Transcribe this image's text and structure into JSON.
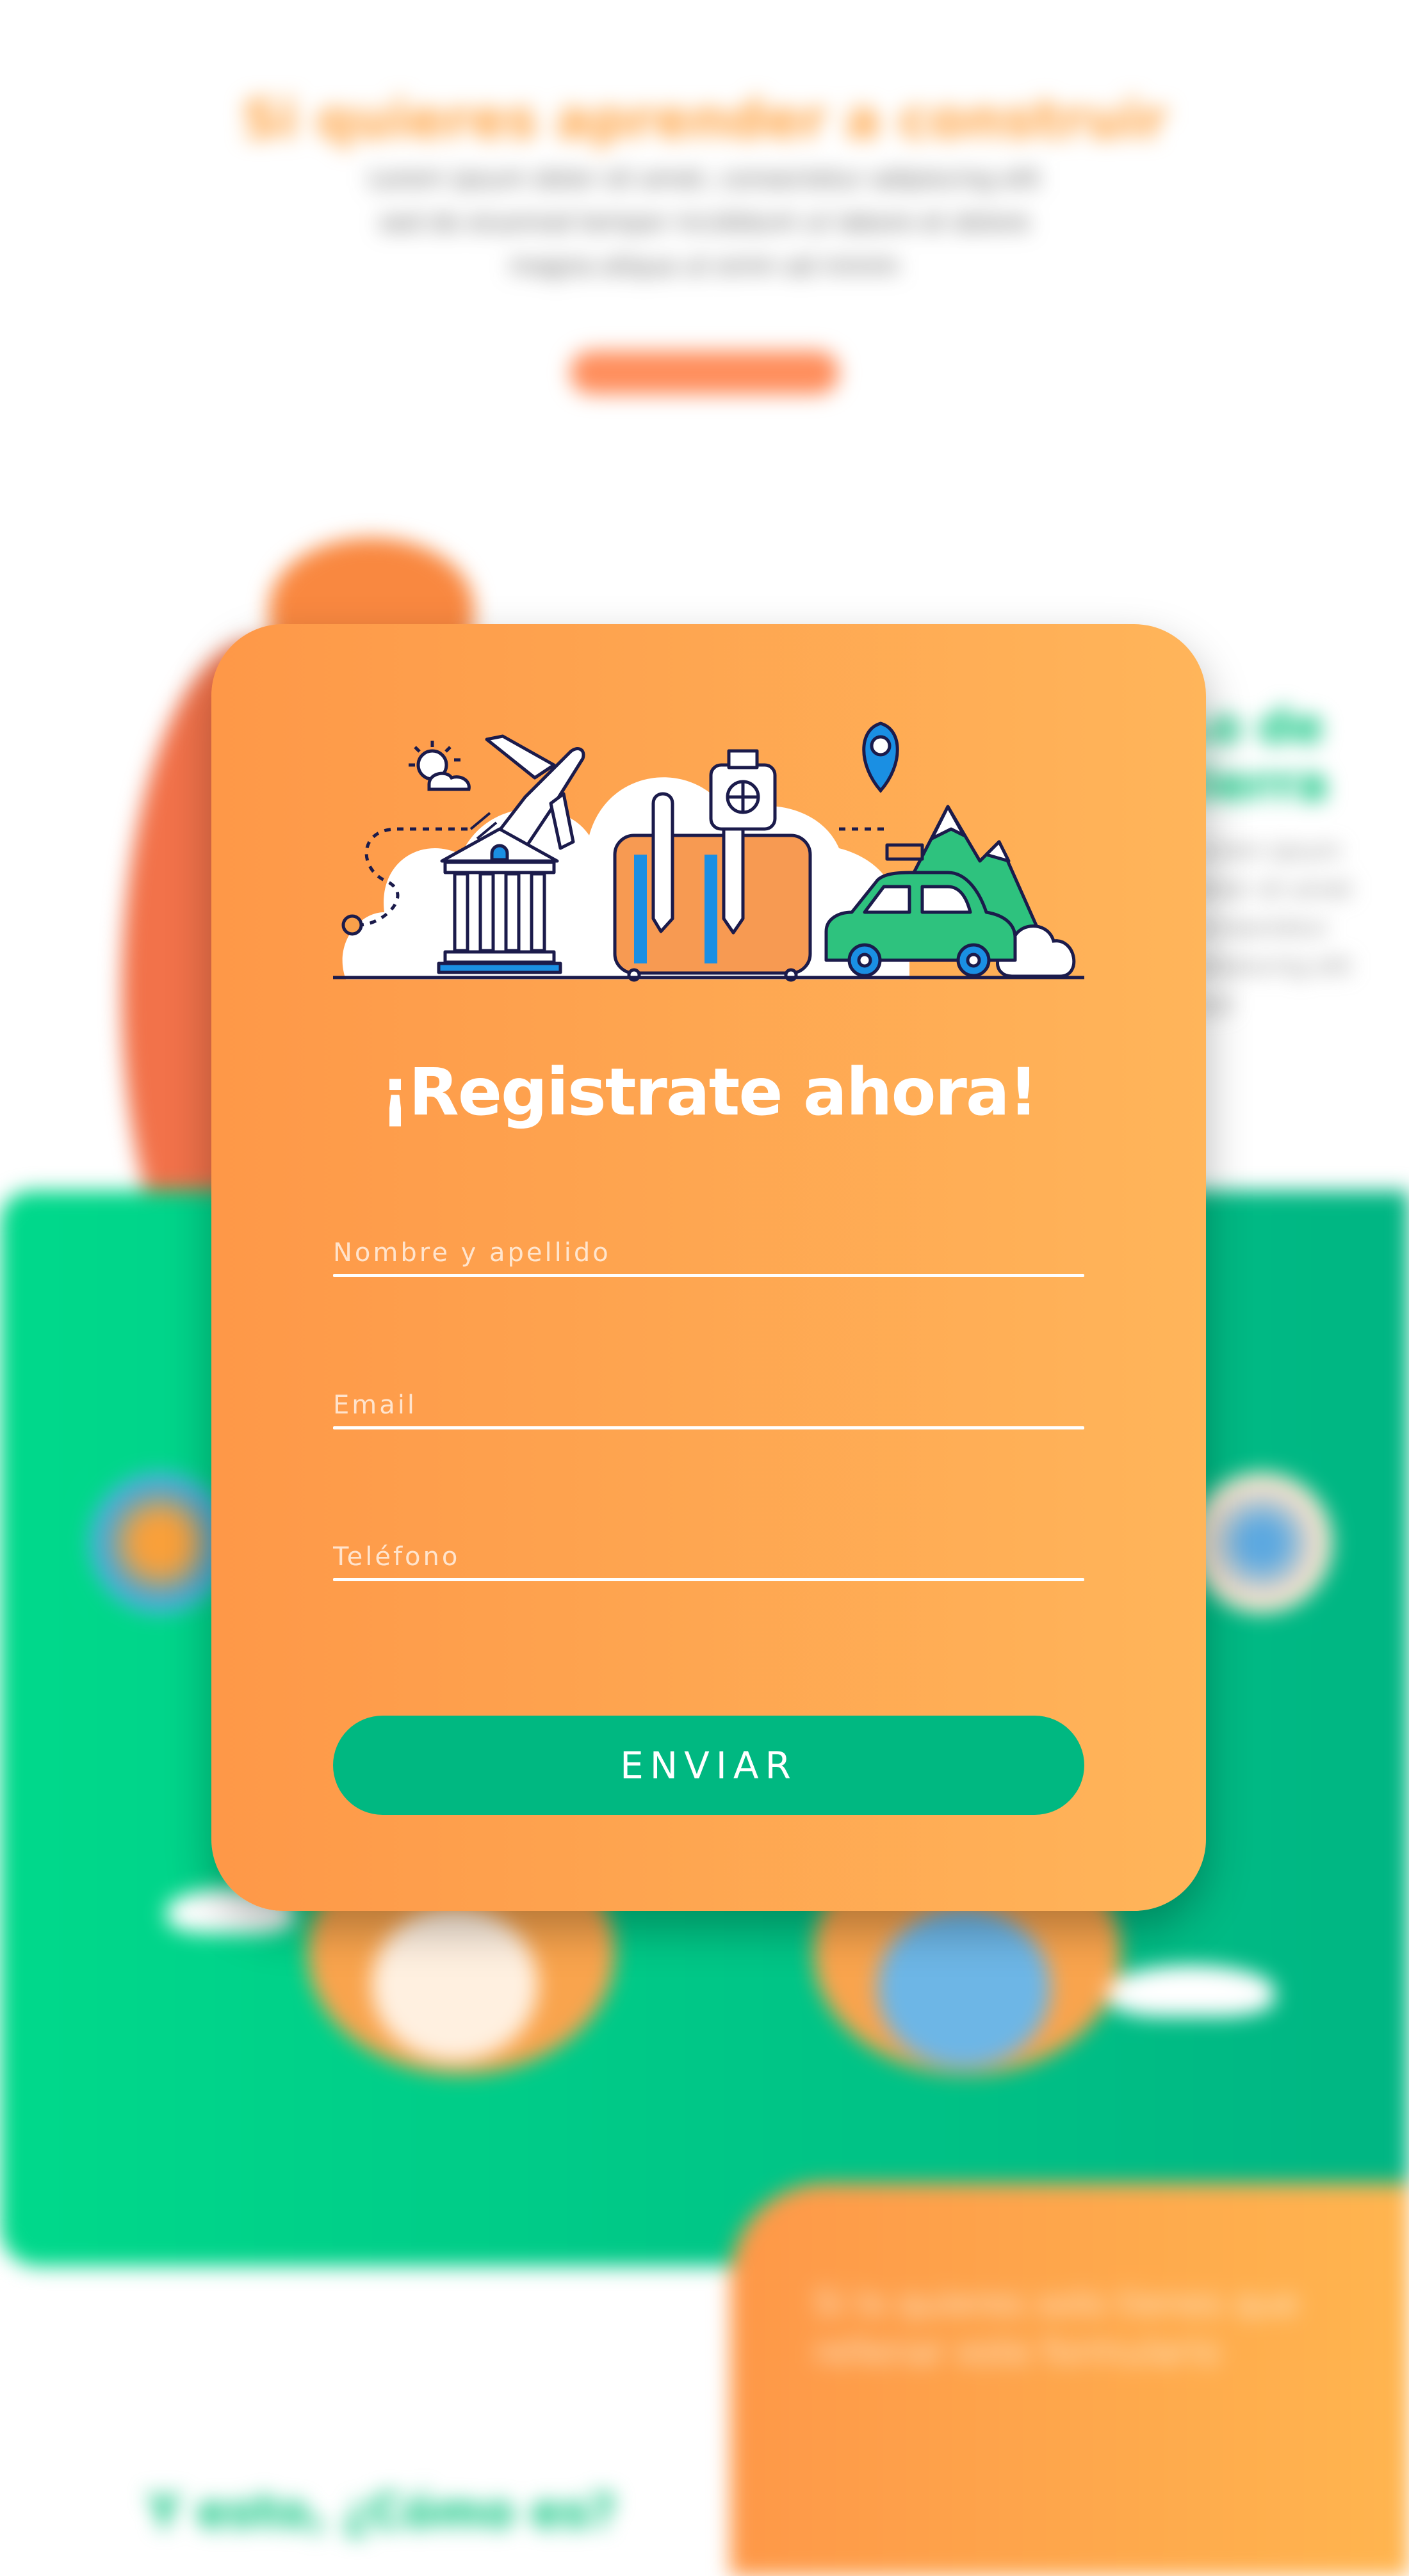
{
  "background": {
    "heading": "Si quieres aprender a construir",
    "paragraph": "Lorem ipsum dolor sit amet, consectetur adipiscing elit sed do eiusmod tempor incididunt ut labore et dolore magna aliqua ut enim ad minim",
    "button_label": "",
    "side_title": "Lo de tierra",
    "side_text": "Lorem ipsum dolor sit amet consectetur adipiscing elit sed",
    "panel_text": "Si lo quieres solo tienes que rellenar este formulario",
    "bottom_title": "Y esto, ¿Cómo es?"
  },
  "form": {
    "title": "¡Registrate ahora!",
    "fields": [
      {
        "placeholder": "Nombre y apellido"
      },
      {
        "placeholder": "Email"
      },
      {
        "placeholder": "Teléfono"
      }
    ],
    "submit_label": "ENVIAR"
  },
  "colors": {
    "card_gradient_start": "#fe9848",
    "card_gradient_end": "#ffb55a",
    "button": "#00b881",
    "green_section": "#00c27a",
    "accent_blue": "#1a8fe3"
  },
  "icons": [
    "sun-icon",
    "airplane-icon",
    "museum-icon",
    "suitcase-icon",
    "location-pin-icon",
    "mountain-icon",
    "taxi-icon",
    "cloud-icon"
  ]
}
